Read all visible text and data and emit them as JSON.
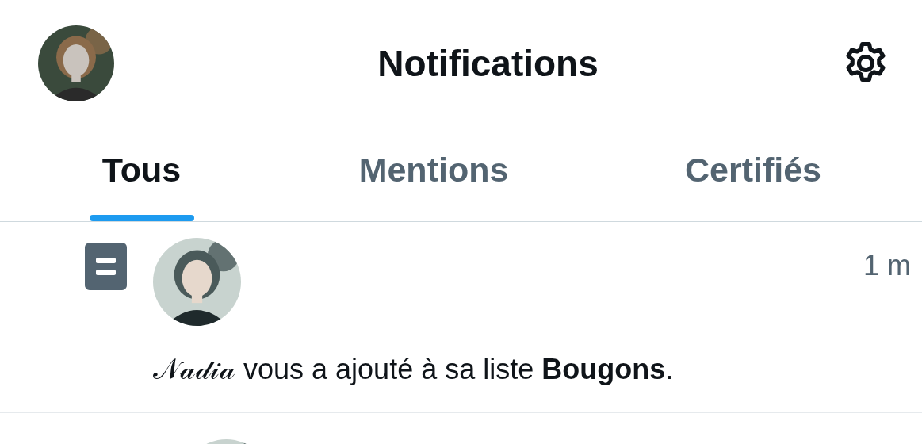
{
  "header": {
    "title": "Notifications"
  },
  "tabs": [
    {
      "label": "Tous",
      "selected": true
    },
    {
      "label": "Mentions",
      "selected": false
    },
    {
      "label": "Certifiés",
      "selected": false
    }
  ],
  "notifications": [
    {
      "kind": "list",
      "time": "1 m",
      "text": "𝒩𝒶𝒹𝒾𝒶 vous a ajouté à sa liste **Bougons**."
    },
    {
      "kind": "partial"
    }
  ]
}
